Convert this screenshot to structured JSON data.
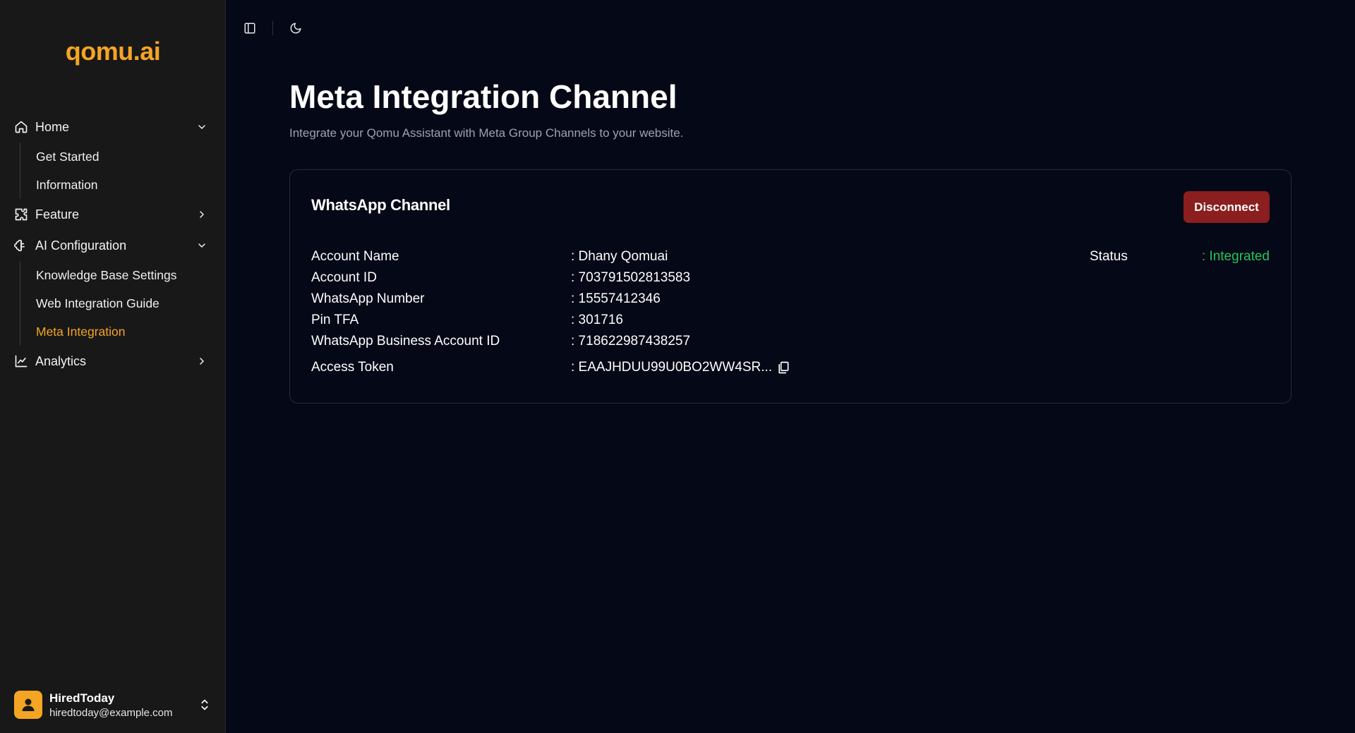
{
  "app": {
    "logo": "qomu.ai"
  },
  "sidebar": {
    "items": [
      {
        "label": "Home",
        "icon": "home-icon",
        "expanded": true,
        "children": [
          {
            "label": "Get Started"
          },
          {
            "label": "Information"
          }
        ]
      },
      {
        "label": "Feature",
        "icon": "puzzle-icon",
        "expanded": false
      },
      {
        "label": "AI Configuration",
        "icon": "brain-icon",
        "expanded": true,
        "children": [
          {
            "label": "Knowledge Base Settings"
          },
          {
            "label": "Web Integration Guide"
          },
          {
            "label": "Meta Integration",
            "active": true
          }
        ]
      },
      {
        "label": "Analytics",
        "icon": "chart-line-icon",
        "expanded": false
      }
    ]
  },
  "user": {
    "name": "HiredToday",
    "email": "hiredtoday@example.com"
  },
  "topbar": {
    "icons": [
      "sidebar-toggle-icon",
      "moon-icon"
    ]
  },
  "page": {
    "title": "Meta Integration Channel",
    "subtitle": "Integrate your Qomu Assistant with Meta Group Channels to your website."
  },
  "card": {
    "title": "WhatsApp Channel",
    "disconnect_label": "Disconnect",
    "fields": [
      {
        "label": "Account Name",
        "value": ": Dhany Qomuai"
      },
      {
        "label": "Account ID",
        "value": ": 703791502813583"
      },
      {
        "label": "WhatsApp Number",
        "value": ": 15557412346"
      },
      {
        "label": "Pin TFA",
        "value": ": 301716"
      },
      {
        "label": "WhatsApp Business Account ID",
        "value": ": 718622987438257"
      },
      {
        "label": "Access Token",
        "value": ": EAAJHDUU99U0BO2WW4SR..."
      }
    ],
    "status_label": "Status",
    "status_value": ": Integrated"
  },
  "colors": {
    "accent": "#f5a524",
    "danger": "#8b1e1e",
    "success": "#22c55e",
    "background": "#050816",
    "sidebar": "#181818"
  }
}
